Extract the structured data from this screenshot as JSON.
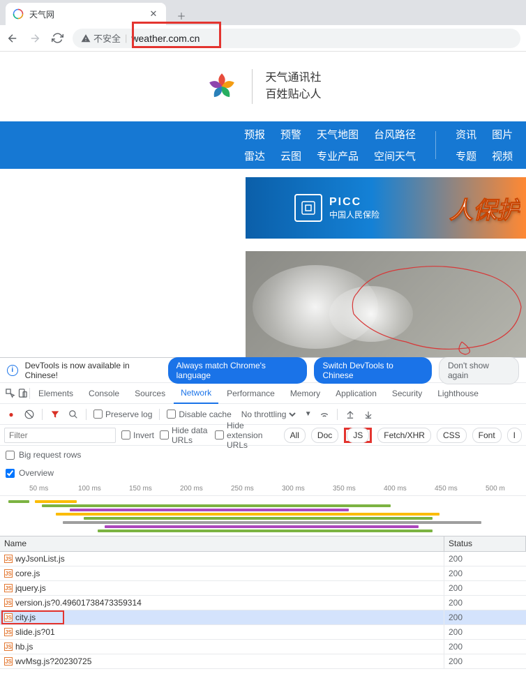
{
  "browser": {
    "tab_title": "天气网",
    "insecure_label": "不安全",
    "url": "weather.com.cn"
  },
  "site": {
    "slogan_1": "天气通讯社",
    "slogan_2": "百姓贴心人",
    "nav": {
      "r1c1": "预报",
      "r2c1": "雷达",
      "r1c2": "预警",
      "r2c2": "云图",
      "r1c3": "天气地图",
      "r2c3": "专业产品",
      "r1c4": "台风路径",
      "r2c4": "空间天气",
      "r1c5": "资讯",
      "r2c5": "专题",
      "r1c6": "图片",
      "r2c6": "视频"
    },
    "banner_brand": "PICC",
    "banner_sub": "中国人民保险",
    "banner_big": "人保护"
  },
  "devtools": {
    "notice": "DevTools is now available in Chinese!",
    "btn_always": "Always match Chrome's language",
    "btn_switch": "Switch DevTools to Chinese",
    "btn_dismiss": "Don't show again",
    "tabs": [
      "Elements",
      "Console",
      "Sources",
      "Network",
      "Performance",
      "Memory",
      "Application",
      "Security",
      "Lighthouse"
    ],
    "active_tab": "Network",
    "toolbar": {
      "preserve": "Preserve log",
      "disable_cache": "Disable cache",
      "throttling": "No throttling"
    },
    "filter": {
      "placeholder": "Filter",
      "invert": "Invert",
      "hide_data": "Hide data URLs",
      "hide_ext": "Hide extension URLs",
      "types": [
        "All",
        "Doc",
        "JS",
        "Fetch/XHR",
        "CSS",
        "Font",
        "I"
      ]
    },
    "big_rows": "Big request rows",
    "overview": "Overview",
    "ruler": [
      "50 ms",
      "100 ms",
      "150 ms",
      "200 ms",
      "250 ms",
      "300 ms",
      "350 ms",
      "400 ms",
      "450 ms",
      "500 m"
    ],
    "columns": {
      "name": "Name",
      "status": "Status"
    },
    "rows": [
      {
        "name": "wyJsonList.js",
        "status": "200"
      },
      {
        "name": "core.js",
        "status": "200"
      },
      {
        "name": "jquery.js",
        "status": "200"
      },
      {
        "name": "version.js?0.49601738473359314",
        "status": "200"
      },
      {
        "name": "city.js",
        "status": "200",
        "selected": true
      },
      {
        "name": "slide.js?01",
        "status": "200"
      },
      {
        "name": "hb.js",
        "status": "200"
      },
      {
        "name": "wvMsg.js?20230725",
        "status": "200"
      }
    ]
  }
}
